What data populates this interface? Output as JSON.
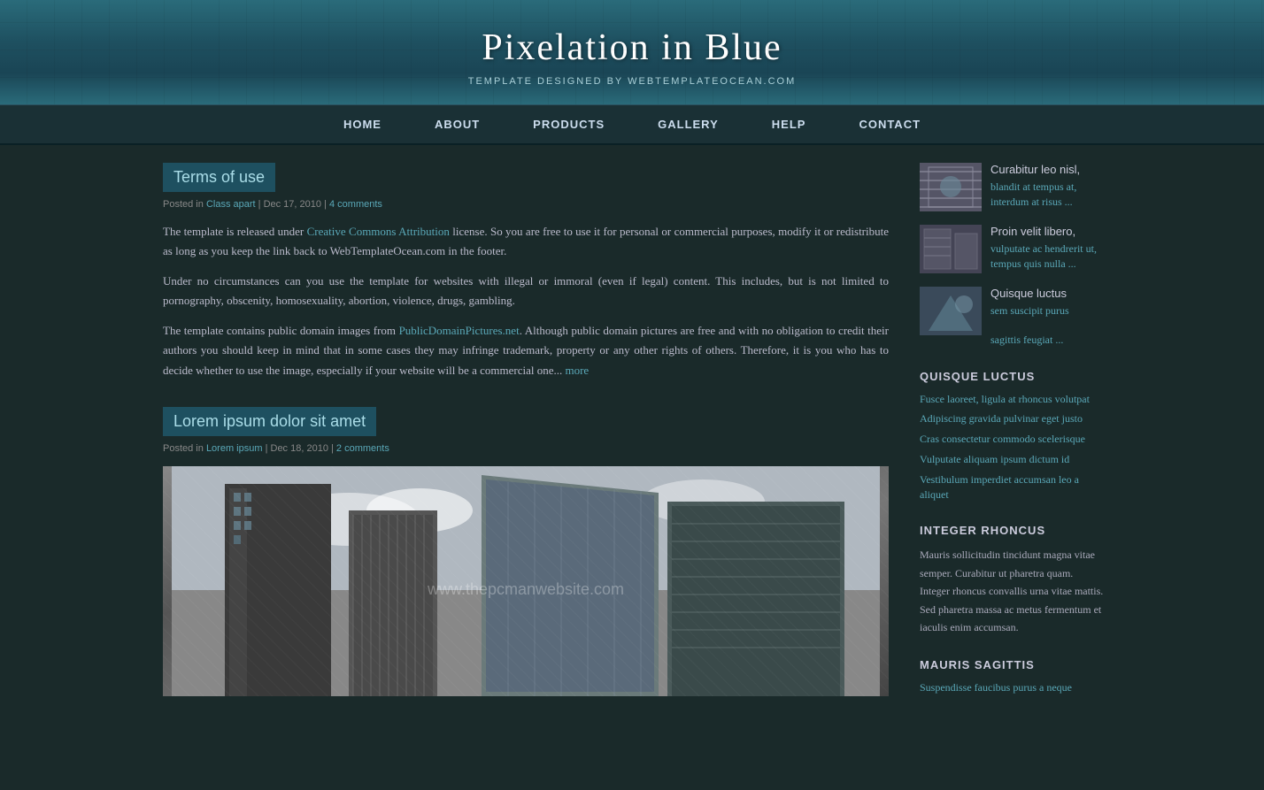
{
  "header": {
    "title": "Pixelation in Blue",
    "subtitle": "TEMPLATE DESIGNED BY WEBTEMPLATEOCEAN.COM"
  },
  "nav": {
    "items": [
      {
        "label": "HOME",
        "href": "#"
      },
      {
        "label": "ABOUT",
        "href": "#"
      },
      {
        "label": "PRODUCTS",
        "href": "#"
      },
      {
        "label": "GALLERY",
        "href": "#"
      },
      {
        "label": "HELP",
        "href": "#"
      },
      {
        "label": "CONTACT",
        "href": "#"
      }
    ]
  },
  "posts": [
    {
      "title": "Terms of use",
      "meta_prefix": "Posted in",
      "category": "Class apart",
      "date": "Dec 17, 2010",
      "comments": "4 comments",
      "body_1": "The template is released under Creative Commons Attribution license. So you are free to use it for personal or commercial purposes, modify it or redistribute as long as you keep the link back to WebTemplateOcean.com in the footer.",
      "body_2": "Under no circumstances can you use the template for websites with illegal or immoral (even if legal) content. This includes, but is not limited to pornography, obscenity, homosexuality, abortion, violence, drugs, gambling.",
      "body_3": "The template contains public domain images from PublicDomainPictures.net. Although public domain pictures are free and with no obligation to credit their authors you should keep in mind that in some cases they may infringe trademark, property or any other rights of others. Therefore, it is you who has to decide whether to use the image, especially if your website will be a commercial one...",
      "read_more": "more",
      "link_creative_commons": "Creative Commons Attribution",
      "link_public_domain": "PublicDomainPictures.net",
      "watermark": "www.thepcmanwebsite.com"
    },
    {
      "title": "Lorem ipsum dolor sit amet",
      "meta_prefix": "Posted in",
      "category": "Lorem ipsum",
      "date": "Dec 18, 2010",
      "comments": "2 comments"
    }
  ],
  "sidebar": {
    "recent_items": [
      {
        "title": "Curabitur leo nisl,",
        "link": "blandit at tempus at, interdum at risus ..."
      },
      {
        "title": "Proin velit libero,",
        "link": "vulputate ac hendrerit ut, tempus quis nulla ..."
      },
      {
        "title": "Quisque luctus",
        "link_1": "sem suscipit purus",
        "link_2": "sagittis feugiat ..."
      }
    ],
    "section1_title": "QUISQUE LUCTUS",
    "section1_links": [
      "Fusce laoreet, ligula at rhoncus volutpat",
      "Adipiscing gravida pulvinar eget justo",
      "Cras consectetur commodo scelerisque",
      "Vulputate aliquam ipsum dictum id",
      "Vestibulum imperdiet accumsan leo a aliquet"
    ],
    "section2_title": "INTEGER RHONCUS",
    "section2_text": "Mauris sollicitudin tincidunt magna vitae semper. Curabitur ut pharetra quam. Integer rhoncus convallis urna vitae mattis. Sed pharetra massa ac metus fermentum et iaculis enim accumsan.",
    "section3_title": "MAURIS SAGITTIS",
    "section3_link": "Suspendisse faucibus purus a neque"
  }
}
